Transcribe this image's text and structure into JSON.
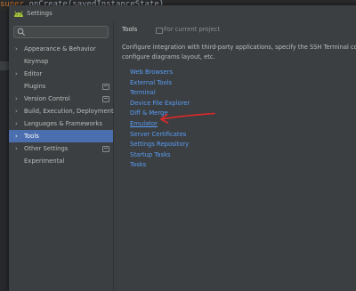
{
  "editor": {
    "code_keyword": "super",
    "code_rest": ".onCreate(savedInstanceState)"
  },
  "dialog": {
    "title": "Settings",
    "icon": "android-icon"
  },
  "sidebar": {
    "search_value": "",
    "items": [
      {
        "label": "Appearance & Behavior",
        "expandable": true,
        "project_icon": false
      },
      {
        "label": "Keymap",
        "expandable": false,
        "project_icon": false
      },
      {
        "label": "Editor",
        "expandable": true,
        "project_icon": false
      },
      {
        "label": "Plugins",
        "expandable": false,
        "project_icon": true
      },
      {
        "label": "Version Control",
        "expandable": true,
        "project_icon": true
      },
      {
        "label": "Build, Execution, Deployment",
        "expandable": true,
        "project_icon": false
      },
      {
        "label": "Languages & Frameworks",
        "expandable": true,
        "project_icon": false
      },
      {
        "label": "Tools",
        "expandable": true,
        "project_icon": false,
        "selected": true
      },
      {
        "label": "Other Settings",
        "expandable": true,
        "project_icon": true
      },
      {
        "label": "Experimental",
        "expandable": false,
        "project_icon": false
      }
    ]
  },
  "content": {
    "breadcrumb": "Tools",
    "scope_label": "For current project",
    "description_line1": "Configure integration with third-party applications, specify the SSH Terminal connecti",
    "description_line2": "configure diagrams layout, etc.",
    "links": [
      "Web Browsers",
      "External Tools",
      "Terminal",
      "Device File Explorer",
      "Diff & Merge",
      "Emulator",
      "Server Certificates",
      "Settings Repository",
      "Startup Tasks",
      "Tasks"
    ],
    "highlighted_link": "Emulator"
  },
  "colors": {
    "background": "#3c3f41",
    "selection": "#4b6eaf",
    "link": "#589df6",
    "annotation": "#e0282a",
    "android": "#a4c639"
  }
}
